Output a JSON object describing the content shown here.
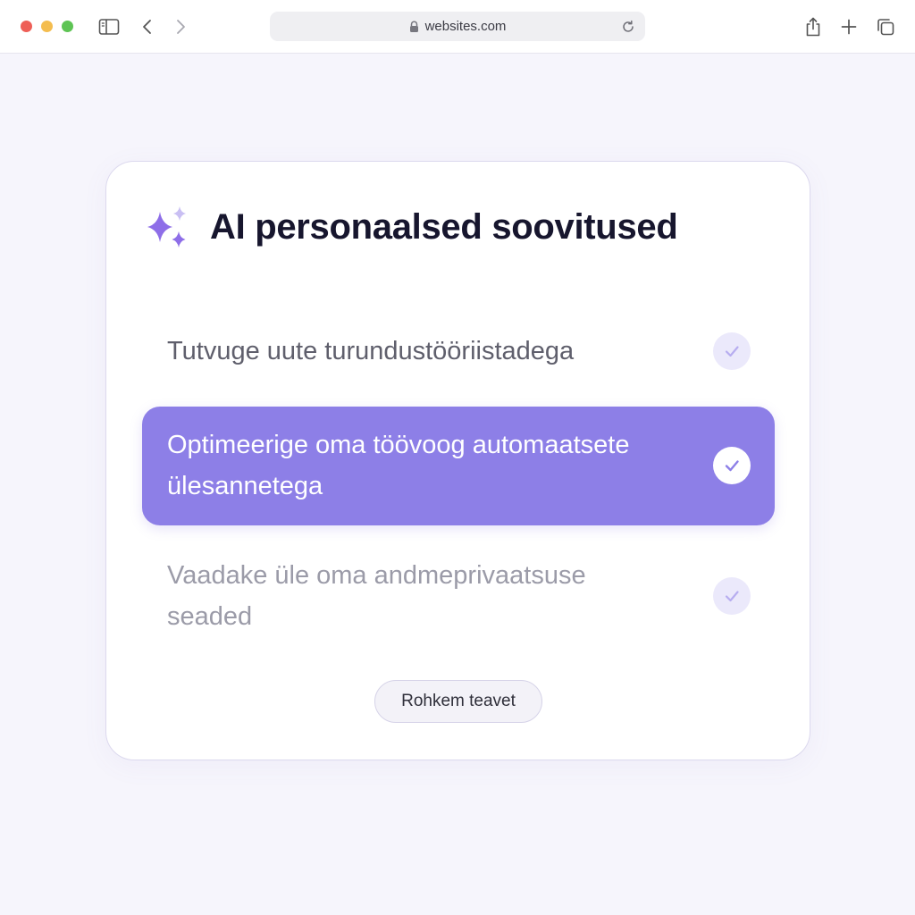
{
  "browser": {
    "url": "websites.com",
    "icons": {
      "sidebar": "sidebar-icon",
      "back": "chevron-left-icon",
      "forward": "chevron-right-icon",
      "lock": "lock-icon",
      "reload": "reload-icon",
      "share": "share-icon",
      "new_tab": "plus-icon",
      "tabs": "tabs-overview-icon"
    }
  },
  "card": {
    "icon": "sparkle-icon",
    "title": "AI personaalsed soovitused",
    "items": [
      {
        "label": "Tutvuge uute turundustööriistadega",
        "state": "default"
      },
      {
        "label": "Optimeerige oma töövoog automaatsete ülesannetega",
        "state": "selected"
      },
      {
        "label": "Vaadake üle oma andmeprivaatsuse seaded",
        "state": "muted"
      }
    ],
    "more_button": "Rohkem teavet"
  },
  "colors": {
    "accent": "#8d7fe7",
    "sparkle_primary": "#8e6ee8",
    "title_text": "#17162e",
    "check_stroke": "#8d7fe7"
  }
}
